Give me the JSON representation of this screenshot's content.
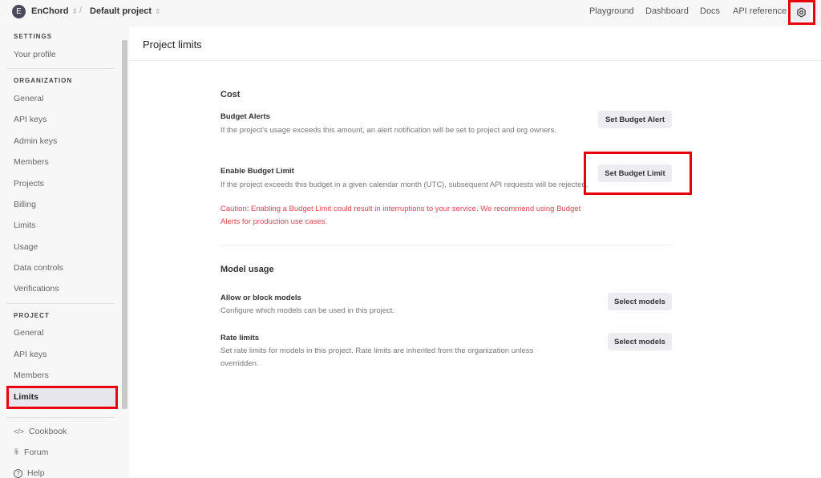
{
  "topbar": {
    "avatar_letter": "E",
    "org": "EnChord",
    "project": "Default project",
    "nav": [
      "Playground",
      "Dashboard",
      "Docs",
      "API reference"
    ],
    "settings_icon": "gear-icon"
  },
  "sidebar": {
    "settings_heading": "SETTINGS",
    "settings_items": [
      "Your profile"
    ],
    "org_heading": "ORGANIZATION",
    "org_items": [
      "General",
      "API keys",
      "Admin keys",
      "Members",
      "Projects",
      "Billing",
      "Limits",
      "Usage",
      "Data controls",
      "Verifications"
    ],
    "project_heading": "PROJECT",
    "project_items": [
      "General",
      "API keys",
      "Members",
      "Limits"
    ],
    "active_item": "Limits",
    "footer": [
      {
        "label": "Cookbook",
        "icon": "code-icon"
      },
      {
        "label": "Forum",
        "icon": "people-icon"
      },
      {
        "label": "Help",
        "icon": "help-icon"
      }
    ]
  },
  "main": {
    "title": "Project limits",
    "cost": {
      "heading": "Cost",
      "budget_alerts": {
        "title": "Budget Alerts",
        "desc": "If the project's usage exceeds this amount, an alert notification will be set to project and org owners.",
        "button": "Set Budget Alert"
      },
      "budget_limit": {
        "title": "Enable Budget Limit",
        "desc": "If the project exceeds this budget in a given calendar month (UTC), subsequent API requests will be rejected.",
        "caution": "Caution: Enabling a Budget Limit could result in interruptions to your service. We recommend using Budget Alerts for production use cases.",
        "button": "Set Budget Limit"
      }
    },
    "model_usage": {
      "heading": "Model usage",
      "allow_block": {
        "title": "Allow or block models",
        "desc": "Configure which models can be used in this project.",
        "button": "Select models"
      },
      "rate_limits": {
        "title": "Rate limits",
        "desc": "Set rate limits for models in this project. Rate limits are inherited from the organization unless overridden.",
        "button": "Select models"
      }
    }
  },
  "highlight_color": "#e8000d"
}
